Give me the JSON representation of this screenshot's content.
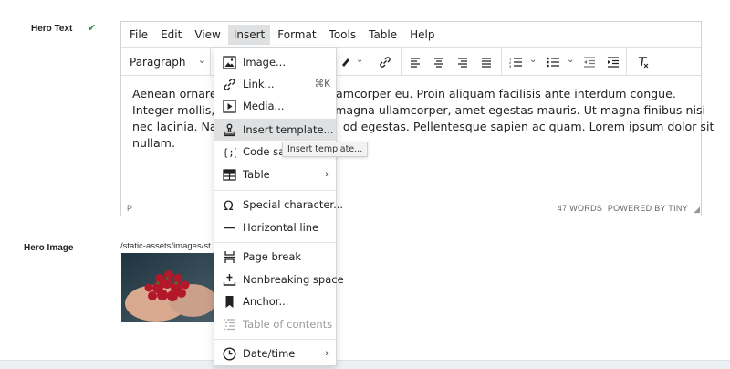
{
  "fields": {
    "hero_text_label": "Hero Text",
    "hero_image_label": "Hero Image",
    "hero_image_path": "/static-assets/images/st"
  },
  "editor": {
    "menubar": [
      "File",
      "Edit",
      "View",
      "Insert",
      "Format",
      "Tools",
      "Table",
      "Help"
    ],
    "active_menu": "Insert",
    "block_format": "Paragraph",
    "content_lines": [
      "Aenean ornare v",
      "Integer mollis, n",
      "nec lacinia. Nam",
      "nullam."
    ],
    "content_lines_right": [
      "n ullamcorper eu. Proin aliquam facilisis ante interdum congue.",
      "tor magna ullamcorper, amet egestas mauris. Ut magna finibus nisi",
      "od egestas. Pellentesque sapien ac quam. Lorem ipsum dolor sit"
    ],
    "status_path": "P",
    "word_count": "47 WORDS",
    "powered_by": "POWERED BY TINY"
  },
  "insert_menu": {
    "items": [
      {
        "label": "Image...",
        "icon": "image-icon"
      },
      {
        "label": "Link...",
        "icon": "link-icon",
        "shortcut": "⌘K"
      },
      {
        "label": "Media...",
        "icon": "media-icon"
      },
      {
        "label": "Insert template...",
        "icon": "template-icon"
      },
      {
        "label": "Code sa",
        "icon": "code-sample-icon"
      },
      {
        "label": "Table",
        "icon": "table-icon",
        "submenu": true
      },
      {
        "label": "Special character...",
        "icon": "omega-icon"
      },
      {
        "label": "Horizontal line",
        "icon": "hr-icon"
      },
      {
        "label": "Page break",
        "icon": "page-break-icon"
      },
      {
        "label": "Nonbreaking space",
        "icon": "nbsp-icon"
      },
      {
        "label": "Anchor...",
        "icon": "bookmark-icon"
      },
      {
        "label": "Table of contents",
        "icon": "toc-icon",
        "disabled": true
      },
      {
        "label": "Date/time",
        "icon": "clock-icon",
        "submenu": true
      }
    ],
    "tooltip": "Insert template..."
  },
  "colors": {
    "check": "#2e8b3e",
    "spellcheck": "#dd3333",
    "menu_highlight": "#dee0e2"
  }
}
